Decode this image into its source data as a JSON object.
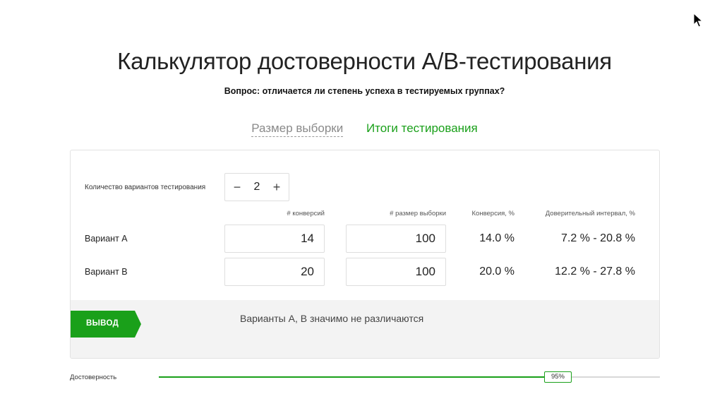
{
  "page": {
    "title": "Калькулятор достоверности А/В-тестирования",
    "subtitle": "Вопрос: отличается ли степень успеха в тестируемых группах?"
  },
  "tabs": [
    {
      "label": "Размер выборки",
      "active": false
    },
    {
      "label": "Итоги тестирования",
      "active": true
    }
  ],
  "variants_count": {
    "label": "Количество вариантов тестирования",
    "value": "2",
    "minus": "−",
    "plus": "+"
  },
  "columns": {
    "conversions": "# конверсий",
    "sample_size": "# размер выборки",
    "conversion_rate": "Конверсия, %",
    "confidence_interval": "Доверительный интервал, %"
  },
  "rows": [
    {
      "label": "Вариант А",
      "conversions": "14",
      "sample_size": "100",
      "rate": "14.0 %",
      "interval": "7.2 % - 20.8 %"
    },
    {
      "label": "Вариант В",
      "conversions": "20",
      "sample_size": "100",
      "rate": "20.0 %",
      "interval": "12.2 % - 27.8 %"
    }
  ],
  "output": {
    "badge": "ВЫВОД",
    "text": "Варианты А, В значимо не различаются"
  },
  "confidence": {
    "label": "Достоверность",
    "value_label": "95%",
    "value": 95
  },
  "colors": {
    "accent": "#1aa01a"
  },
  "icons": {
    "cursor": "mouse-pointer-icon"
  }
}
